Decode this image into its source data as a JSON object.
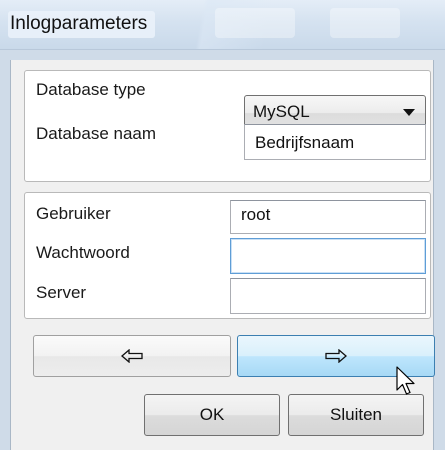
{
  "window": {
    "title": "Inlogparameters"
  },
  "database": {
    "type_label": "Database type",
    "type_value": "MySQL",
    "name_label": "Database naam",
    "name_value": "Bedrijfsnaam"
  },
  "login": {
    "user_label": "Gebruiker",
    "user_value": "root",
    "password_label": "Wachtwoord",
    "password_value": "",
    "server_label": "Server",
    "server_value": ""
  },
  "buttons": {
    "prev_icon": "left-arrow-icon",
    "next_icon": "right-arrow-icon",
    "ok_label": "OK",
    "close_label": "Sluiten"
  },
  "colors": {
    "title_bar": "#d5e2f0",
    "hover_button": "#bee6fd",
    "focus_border": "#5f9dd6"
  }
}
